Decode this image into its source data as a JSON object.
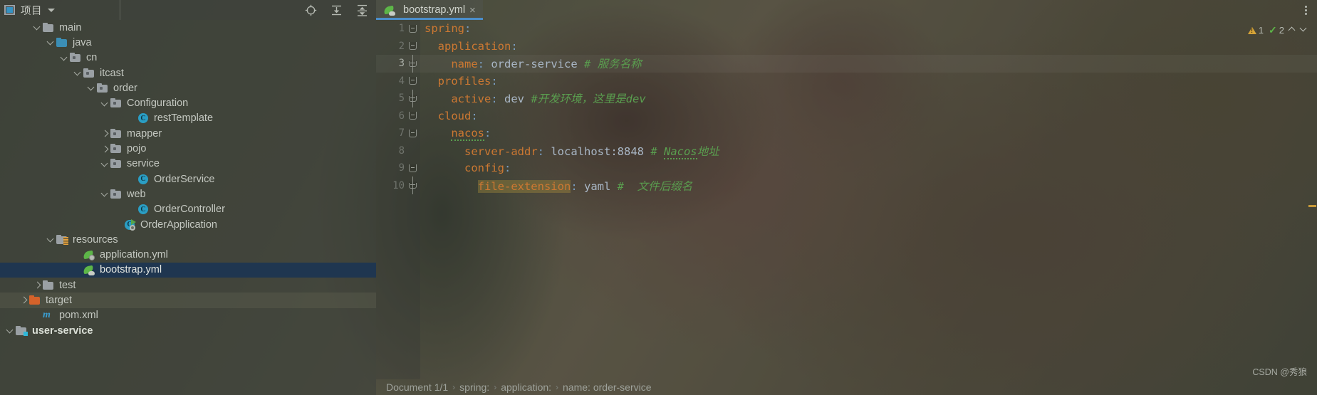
{
  "project_pane": {
    "title": "项目",
    "icons": {
      "window_icon": "project-window-icon",
      "dropdown": "chevron-down-icon",
      "locate": "locate-file-icon",
      "expand_all": "expand-all-icon",
      "collapse_all": "collapse-all-icon"
    },
    "tree": [
      {
        "label": "main",
        "indent": 2,
        "arrow": "down",
        "icon": "folder",
        "state": "normal"
      },
      {
        "label": "java",
        "indent": 3,
        "arrow": "down",
        "icon": "java-folder",
        "state": "normal"
      },
      {
        "label": "cn",
        "indent": 4,
        "arrow": "down",
        "icon": "package",
        "state": "normal"
      },
      {
        "label": "itcast",
        "indent": 5,
        "arrow": "down",
        "icon": "package",
        "state": "normal"
      },
      {
        "label": "order",
        "indent": 6,
        "arrow": "down",
        "icon": "package",
        "state": "normal"
      },
      {
        "label": "Configuration",
        "indent": 7,
        "arrow": "down",
        "icon": "package",
        "state": "normal"
      },
      {
        "label": "restTemplate",
        "indent": 9,
        "arrow": "none",
        "icon": "class",
        "state": "normal"
      },
      {
        "label": "mapper",
        "indent": 7,
        "arrow": "right",
        "icon": "package",
        "state": "normal"
      },
      {
        "label": "pojo",
        "indent": 7,
        "arrow": "right",
        "icon": "package",
        "state": "normal"
      },
      {
        "label": "service",
        "indent": 7,
        "arrow": "down",
        "icon": "package",
        "state": "normal"
      },
      {
        "label": "OrderService",
        "indent": 9,
        "arrow": "none",
        "icon": "class",
        "state": "normal"
      },
      {
        "label": "web",
        "indent": 7,
        "arrow": "down",
        "icon": "package",
        "state": "normal"
      },
      {
        "label": "OrderController",
        "indent": 9,
        "arrow": "none",
        "icon": "class",
        "state": "normal"
      },
      {
        "label": "OrderApplication",
        "indent": 8,
        "arrow": "none",
        "icon": "runnable-class",
        "state": "normal"
      },
      {
        "label": "resources",
        "indent": 3,
        "arrow": "down",
        "icon": "resources-folder",
        "state": "normal"
      },
      {
        "label": "application.yml",
        "indent": 5,
        "arrow": "none",
        "icon": "spring-config",
        "state": "normal"
      },
      {
        "label": "bootstrap.yml",
        "indent": 5,
        "arrow": "none",
        "icon": "spring-leaf",
        "state": "selected"
      },
      {
        "label": "test",
        "indent": 2,
        "arrow": "right",
        "icon": "folder",
        "state": "normal"
      },
      {
        "label": "target",
        "indent": 1,
        "arrow": "right",
        "icon": "target-folder",
        "state": "highlight"
      },
      {
        "label": "pom.xml",
        "indent": 2,
        "arrow": "none",
        "icon": "maven",
        "state": "normal"
      },
      {
        "label": "user-service",
        "indent": 0,
        "arrow": "down",
        "icon": "module",
        "state": "bold"
      }
    ]
  },
  "editor": {
    "tab": {
      "name": "bootstrap.yml",
      "icon": "spring-leaf-icon",
      "close": "×"
    },
    "more_actions_icon": "kebab-menu-icon",
    "inspections": {
      "warning_icon": "warning-triangle-icon",
      "warning_count": "1",
      "ok_icon": "inspection-ok-icon",
      "ok_count": "2",
      "prev_icon": "chevron-up-icon",
      "next_icon": "chevron-down-icon"
    },
    "lines": [
      {
        "num": "1",
        "fold": "open",
        "current": false,
        "tokens": [
          {
            "t": "spring",
            "c": "k"
          },
          {
            "t": ":",
            "c": "p"
          }
        ]
      },
      {
        "num": "2",
        "fold": "open",
        "current": false,
        "tokens": [
          {
            "t": "  ",
            "c": "v"
          },
          {
            "t": "application",
            "c": "k"
          },
          {
            "t": ":",
            "c": "p"
          }
        ]
      },
      {
        "num": "3",
        "fold": "mid",
        "current": true,
        "tokens": [
          {
            "t": "    ",
            "c": "v"
          },
          {
            "t": "name",
            "c": "k"
          },
          {
            "t": ":",
            "c": "p"
          },
          {
            "t": " order-service ",
            "c": "v"
          },
          {
            "t": "# 服务名称",
            "c": "c"
          }
        ]
      },
      {
        "num": "4",
        "fold": "open",
        "current": false,
        "tokens": [
          {
            "t": "  ",
            "c": "v"
          },
          {
            "t": "profiles",
            "c": "k"
          },
          {
            "t": ":",
            "c": "p"
          }
        ]
      },
      {
        "num": "5",
        "fold": "mid",
        "current": false,
        "tokens": [
          {
            "t": "    ",
            "c": "v"
          },
          {
            "t": "active",
            "c": "k"
          },
          {
            "t": ":",
            "c": "p"
          },
          {
            "t": " dev ",
            "c": "v"
          },
          {
            "t": "#开发环境，这里是dev",
            "c": "c"
          }
        ]
      },
      {
        "num": "6",
        "fold": "open",
        "current": false,
        "tokens": [
          {
            "t": "  ",
            "c": "v"
          },
          {
            "t": "cloud",
            "c": "k"
          },
          {
            "t": ":",
            "c": "p"
          }
        ]
      },
      {
        "num": "7",
        "fold": "open",
        "current": false,
        "tokens": [
          {
            "t": "    ",
            "c": "v"
          },
          {
            "t": "nacos",
            "c": "k sq"
          },
          {
            "t": ":",
            "c": "p"
          }
        ]
      },
      {
        "num": "8",
        "fold": "none",
        "current": false,
        "tokens": [
          {
            "t": "      ",
            "c": "v"
          },
          {
            "t": "server-addr",
            "c": "k"
          },
          {
            "t": ":",
            "c": "p"
          },
          {
            "t": " localhost:8848 ",
            "c": "v"
          },
          {
            "t": "# ",
            "c": "c"
          },
          {
            "t": "Nacos",
            "c": "c sq"
          },
          {
            "t": "地址",
            "c": "c"
          }
        ]
      },
      {
        "num": "9",
        "fold": "open",
        "current": false,
        "tokens": [
          {
            "t": "      ",
            "c": "v"
          },
          {
            "t": "config",
            "c": "k"
          },
          {
            "t": ":",
            "c": "p"
          }
        ]
      },
      {
        "num": "10",
        "fold": "mid",
        "current": false,
        "tokens": [
          {
            "t": "        ",
            "c": "v"
          },
          {
            "t": "file-extension",
            "c": "k hlmatch"
          },
          {
            "t": ":",
            "c": "p"
          },
          {
            "t": " yaml ",
            "c": "v"
          },
          {
            "t": "#  文件后缀名",
            "c": "c"
          }
        ]
      }
    ]
  },
  "statusbar": {
    "breadcrumbs": [
      "Document 1/1",
      "spring:",
      "application:",
      "name: order-service"
    ],
    "separator": "›"
  },
  "watermark": "CSDN @秀狼",
  "colors": {
    "accent": "#4b8ecb",
    "selection": "#1f3650",
    "key": "#cc7832",
    "value": "#a9b7c6",
    "comment": "#5a9e4f",
    "warning": "#d6a338",
    "ok": "#5db648",
    "target_folder": "#d4622a",
    "java_folder": "#3b8eb5"
  }
}
